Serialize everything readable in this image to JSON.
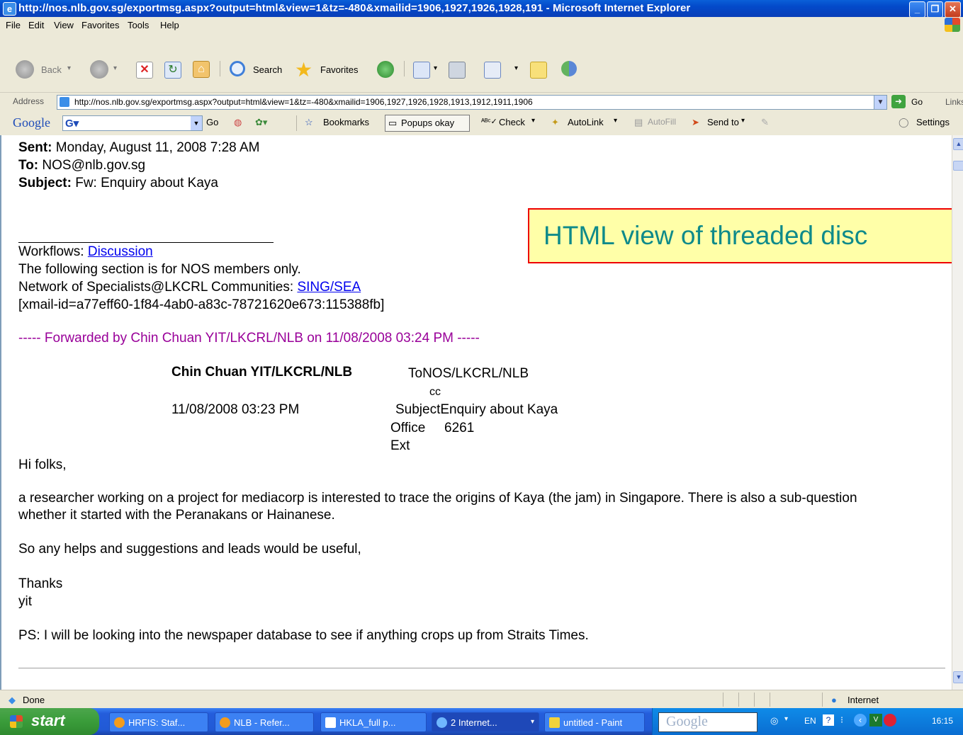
{
  "window": {
    "title": "http://nos.nlb.gov.sg/exportmsg.aspx?output=html&view=1&tz=-480&xmailid=1906,1927,1926,1928,191 - Microsoft Internet Explorer"
  },
  "menu": [
    "File",
    "Edit",
    "View",
    "Favorites",
    "Tools",
    "Help"
  ],
  "toolbar": {
    "back_label": "Back",
    "search_label": "Search",
    "favorites_label": "Favorites"
  },
  "address": {
    "label": "Address",
    "url": "http://nos.nlb.gov.sg/exportmsg.aspx?output=html&view=1&tz=-480&xmailid=1906,1927,1926,1928,1913,1912,1911,1906",
    "go_label": "Go",
    "links_label": "Links"
  },
  "google_toolbar": {
    "logo": "Google",
    "go_label": "Go",
    "bookmarks_label": "Bookmarks",
    "popups_label": "Popups okay",
    "check_label": "Check",
    "autolink_label": "AutoLink",
    "autofill_label": "AutoFill",
    "sendto_label": "Send to",
    "settings_label": "Settings"
  },
  "email": {
    "sent_label": "Sent:",
    "sent_value": "Monday, August 11, 2008 7:28 AM",
    "to_label": "To:",
    "to_value": "NOS@nlb.gov.sg",
    "subject_label": "Subject:",
    "subject_value": "Fw: Enquiry about Kaya",
    "workflows_label": "Workflows:",
    "workflows_link": "Discussion",
    "nos_only": "The following section is for NOS members only.",
    "network_label": "Network of Specialists@LKCRL Communities:",
    "network_link": "SING/SEA",
    "xmail_id": "[xmail-id=a77eff60-1f84-4ab0-a83c-78721620e673:115388fb]",
    "forwarded": "----- Forwarded by Chin Chuan YIT/LKCRL/NLB on 11/08/2008 03:24 PM -----",
    "from_name": "Chin Chuan YIT/LKCRL/NLB",
    "from_date": "11/08/2008 03:23 PM",
    "to_line": "ToNOS/LKCRL/NLB",
    "cc_line": "cc",
    "subject_line": "SubjectEnquiry about Kaya",
    "office_label": "Office",
    "office_ext_label": "Ext",
    "office_value": "6261",
    "greeting": "Hi folks,",
    "body_line1": "a researcher working on a project for mediacorp is interested to trace the origins of Kaya (the jam) in Singapore. There is also a sub-question",
    "body_line2": "whether it started with the Peranakans or Hainanese.",
    "body_line3": "So any helps and suggestions and leads would be useful,",
    "thanks": "Thanks",
    "signoff": "yit",
    "ps": "PS: I will be looking into the newspaper database to see if anything crops up from Straits Times."
  },
  "callout": "HTML view of threaded disc",
  "status": {
    "left": "Done",
    "zone": "Internet"
  },
  "taskbar": {
    "start": "start",
    "tasks": [
      {
        "label": "HRFIS: Staf..."
      },
      {
        "label": "NLB - Refer..."
      },
      {
        "label": "HKLA_full p..."
      },
      {
        "label": "2 Internet..."
      },
      {
        "label": "untitled - Paint"
      }
    ],
    "tray_google": "Google",
    "lang": "EN",
    "clock": "16:15"
  }
}
